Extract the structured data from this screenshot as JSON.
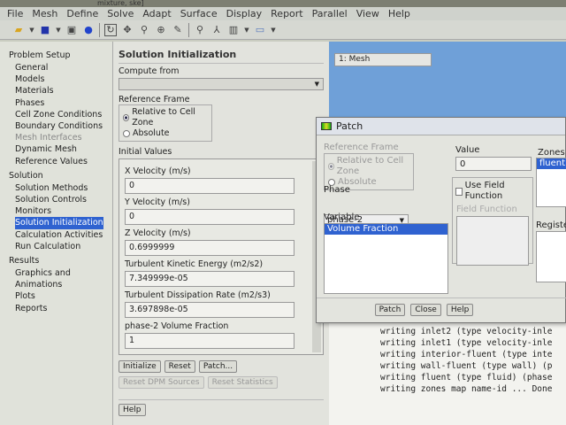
{
  "window": {
    "title_fragment": "mixture, ske]"
  },
  "menu": [
    "File",
    "Mesh",
    "Define",
    "Solve",
    "Adapt",
    "Surface",
    "Display",
    "Report",
    "Parallel",
    "View",
    "Help"
  ],
  "toolbar_icons": [
    "open-icon",
    "dropdown-icon",
    "save-icon",
    "dropdown-icon",
    "camera-icon",
    "help-icon",
    "rotate-icon",
    "pan-icon",
    "zoom-icon",
    "zoom-in-icon",
    "probe-icon",
    "zoom-fit-icon",
    "axes-icon",
    "layout-icon",
    "dropdown-icon",
    "window-icon",
    "dropdown-icon"
  ],
  "tree": {
    "groups": [
      {
        "label": "Problem Setup",
        "items": [
          {
            "label": "General"
          },
          {
            "label": "Models"
          },
          {
            "label": "Materials"
          },
          {
            "label": "Phases"
          },
          {
            "label": "Cell Zone Conditions"
          },
          {
            "label": "Boundary Conditions"
          },
          {
            "label": "Mesh Interfaces",
            "disabled": true
          },
          {
            "label": "Dynamic Mesh"
          },
          {
            "label": "Reference Values"
          }
        ]
      },
      {
        "label": "Solution",
        "items": [
          {
            "label": "Solution Methods"
          },
          {
            "label": "Solution Controls"
          },
          {
            "label": "Monitors"
          },
          {
            "label": "Solution Initialization",
            "selected": true
          },
          {
            "label": "Calculation Activities"
          },
          {
            "label": "Run Calculation"
          }
        ]
      },
      {
        "label": "Results",
        "items": [
          {
            "label": "Graphics and Animations"
          },
          {
            "label": "Plots"
          },
          {
            "label": "Reports"
          }
        ]
      }
    ]
  },
  "task": {
    "title": "Solution Initialization",
    "compute_from_label": "Compute from",
    "compute_from_value": "",
    "ref_frame_label": "Reference Frame",
    "ref_relative": "Relative to Cell Zone",
    "ref_absolute": "Absolute",
    "initial_values_label": "Initial Values",
    "fields": [
      {
        "label": "X Velocity (m/s)",
        "value": "0"
      },
      {
        "label": "Y Velocity (m/s)",
        "value": "0"
      },
      {
        "label": "Z Velocity (m/s)",
        "value": "0.6999999"
      },
      {
        "label": "Turbulent Kinetic Energy (m2/s2)",
        "value": "7.349999e-05"
      },
      {
        "label": "Turbulent Dissipation Rate (m2/s3)",
        "value": "3.697898e-05"
      },
      {
        "label": "phase-2 Volume Fraction",
        "value": "1"
      }
    ],
    "initialize": "Initialize",
    "reset": "Reset",
    "patch": "Patch...",
    "reset_dpm": "Reset DPM Sources",
    "reset_stats": "Reset Statistics",
    "help": "Help"
  },
  "graphics": {
    "window_label": "1: Mesh"
  },
  "console": [
    "writing inlet2 (type velocity-inle",
    "writing inlet1 (type velocity-inle",
    "writing interior-fluent (type inte",
    "writing wall-fluent (type wall) (p",
    "writing fluent (type fluid) (phase",
    "writing zones map name-id ... Done"
  ],
  "patch": {
    "title": "Patch",
    "ref_frame_label": "Reference Frame",
    "ref_relative": "Relative to Cell Zone",
    "ref_absolute": "Absolute",
    "phase_label": "Phase",
    "phase_value": "phase-2",
    "variable_label": "Variable",
    "variables": [
      "Volume Fraction"
    ],
    "value_label": "Value",
    "value": "0",
    "use_field_function": "Use Field Function",
    "field_function_label": "Field Function",
    "zones_label": "Zones to",
    "zones": [
      "fluent"
    ],
    "registers_label": "Registers",
    "patch_btn": "Patch",
    "close_btn": "Close",
    "help_btn": "Help"
  }
}
